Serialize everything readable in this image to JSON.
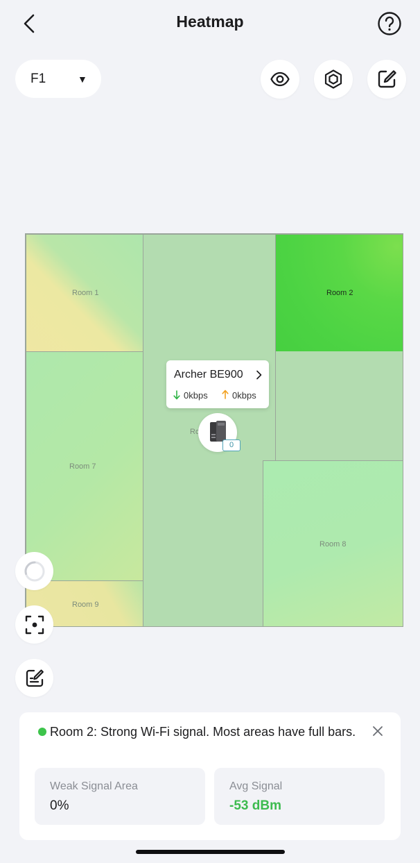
{
  "header": {
    "title": "Heatmap"
  },
  "floor_select": {
    "value": "F1"
  },
  "rooms": {
    "room1": "Room 1",
    "room2": "Room 2",
    "room_center": "Ro",
    "room7": "Room 7",
    "room8": "Room 8",
    "room9": "Room 9"
  },
  "device": {
    "name": "Archer BE900",
    "download": "0kbps",
    "upload": "0kbps",
    "client_count": "0"
  },
  "info_card": {
    "message": "Room 2: Strong Wi-Fi signal. Most areas have full bars.",
    "status_color": "#3dc44b",
    "weak_label": "Weak Signal Area",
    "weak_value": "0%",
    "avg_label": "Avg Signal",
    "avg_value": "-53 dBm",
    "avg_color": "#3dbb4f"
  },
  "icons": {
    "back": "chevron-left-icon",
    "help": "question-circle-icon",
    "visibility": "eye-icon",
    "layers": "hexagon-icon",
    "edit": "edit-square-icon",
    "loading": "spinner-icon",
    "locate": "focus-icon",
    "notes": "note-edit-icon",
    "close": "close-icon"
  }
}
